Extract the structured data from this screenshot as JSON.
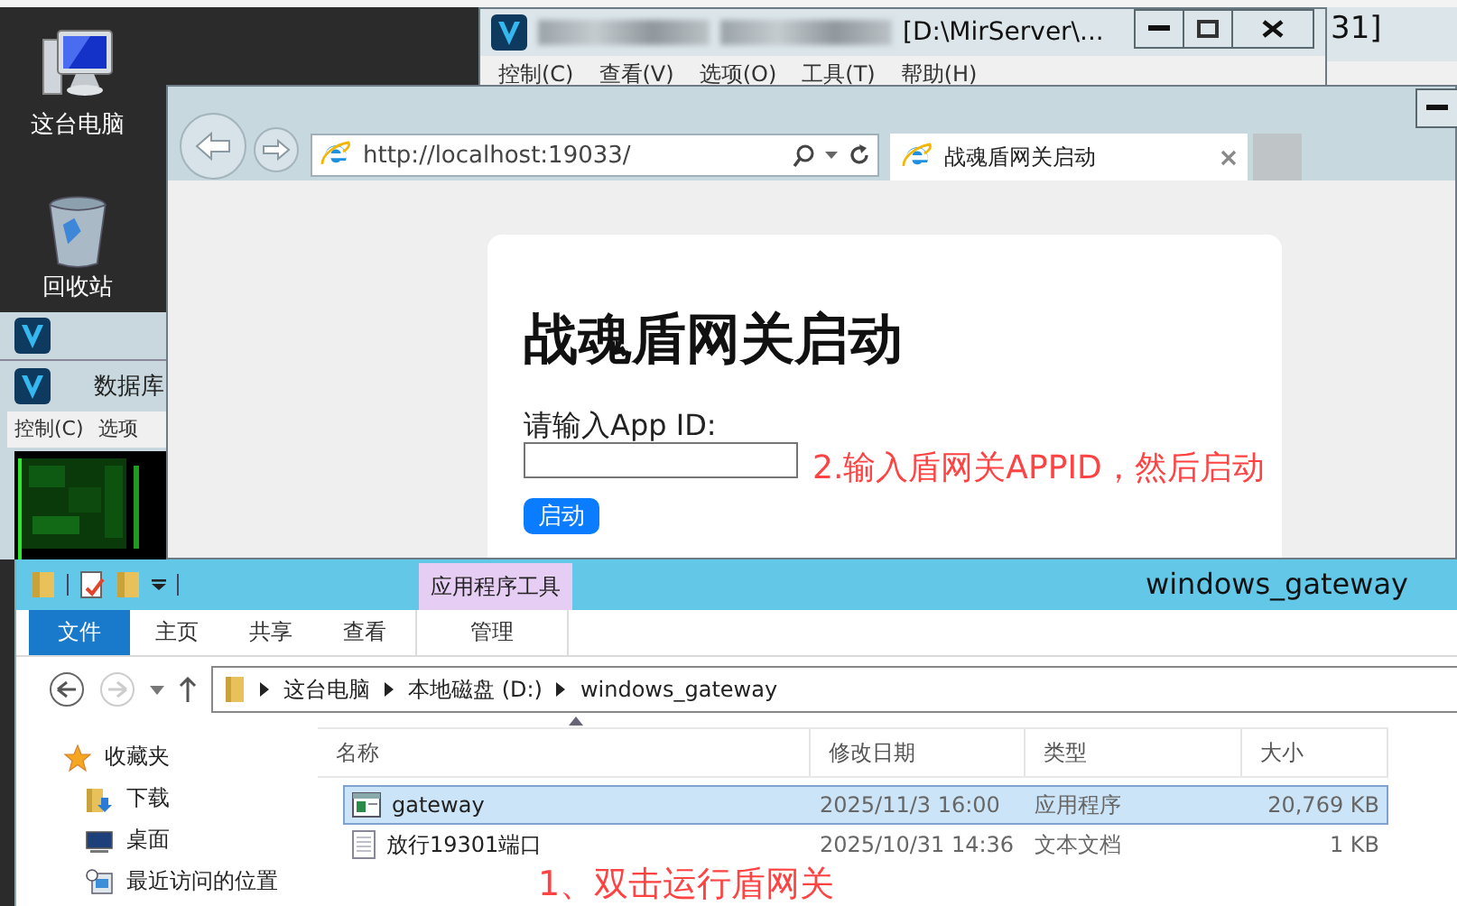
{
  "desktop_icons": [
    {
      "label": "这台电脑",
      "kind": "computer"
    },
    {
      "label": "回收站",
      "kind": "recycle"
    }
  ],
  "account_server_window": {
    "title": "[D:\\MirServer\\...",
    "menu": [
      "控制(C)",
      "查看(V)",
      "选项(O)",
      "工具(T)",
      "帮助(H)"
    ]
  },
  "background_window": {
    "title": "31]"
  },
  "database_window": {
    "title": "数据库",
    "menu": [
      "控制(C)",
      "选项"
    ]
  },
  "browser": {
    "url": "http://localhost:19033/",
    "tab": {
      "title": "战魂盾网关启动"
    },
    "page": {
      "heading": "战魂盾网关启动",
      "label": "请输入App ID:",
      "button": "启动"
    }
  },
  "explorer": {
    "title": "windows_gateway",
    "context_tab": "应用程序工具",
    "ribbon_tabs": [
      {
        "label": "文件",
        "kind": "file"
      },
      {
        "label": "主页",
        "kind": "tab"
      },
      {
        "label": "共享",
        "kind": "tab"
      },
      {
        "label": "查看",
        "kind": "tab"
      },
      {
        "label": "管理",
        "kind": "context"
      }
    ],
    "path": [
      "这台电脑",
      "本地磁盘 (D:)",
      "windows_gateway"
    ],
    "nav": [
      {
        "label": "收藏夹",
        "kind": "star"
      },
      {
        "label": "下载",
        "kind": "download"
      },
      {
        "label": "桌面",
        "kind": "desktop"
      },
      {
        "label": "最近访问的位置",
        "kind": "recent"
      }
    ],
    "columns": [
      "名称",
      "修改日期",
      "类型",
      "大小"
    ],
    "files": [
      {
        "name": "gateway",
        "date": "2025/11/3 16:00",
        "type": "应用程序",
        "size": "20,769 KB",
        "kind": "app",
        "selected": true
      },
      {
        "name": "放行19301端口",
        "date": "2025/10/31 14:36",
        "type": "文本文档",
        "size": "1 KB",
        "kind": "text",
        "selected": false
      }
    ]
  },
  "annotations": [
    {
      "text": "2.输入盾网关APPID，然后启动",
      "kind": "browser"
    },
    {
      "text": "1、双击运行盾网关",
      "kind": "explorer"
    }
  ]
}
